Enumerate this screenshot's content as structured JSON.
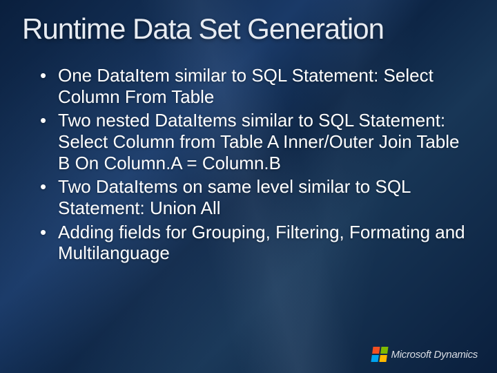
{
  "title": "Runtime Data Set Generation",
  "bullets": [
    "One DataItem similar to SQL Statement: Select Column From Table",
    "Two nested DataItems similar to SQL Statement: Select Column from Table A Inner/Outer Join Table B On Column.A = Column.B",
    "Two DataItems on same level similar to SQL Statement: Union All",
    "Adding fields for Grouping, Filtering, Formating and Multilanguage"
  ],
  "footer": {
    "brand": "Microsoft Dynamics"
  }
}
